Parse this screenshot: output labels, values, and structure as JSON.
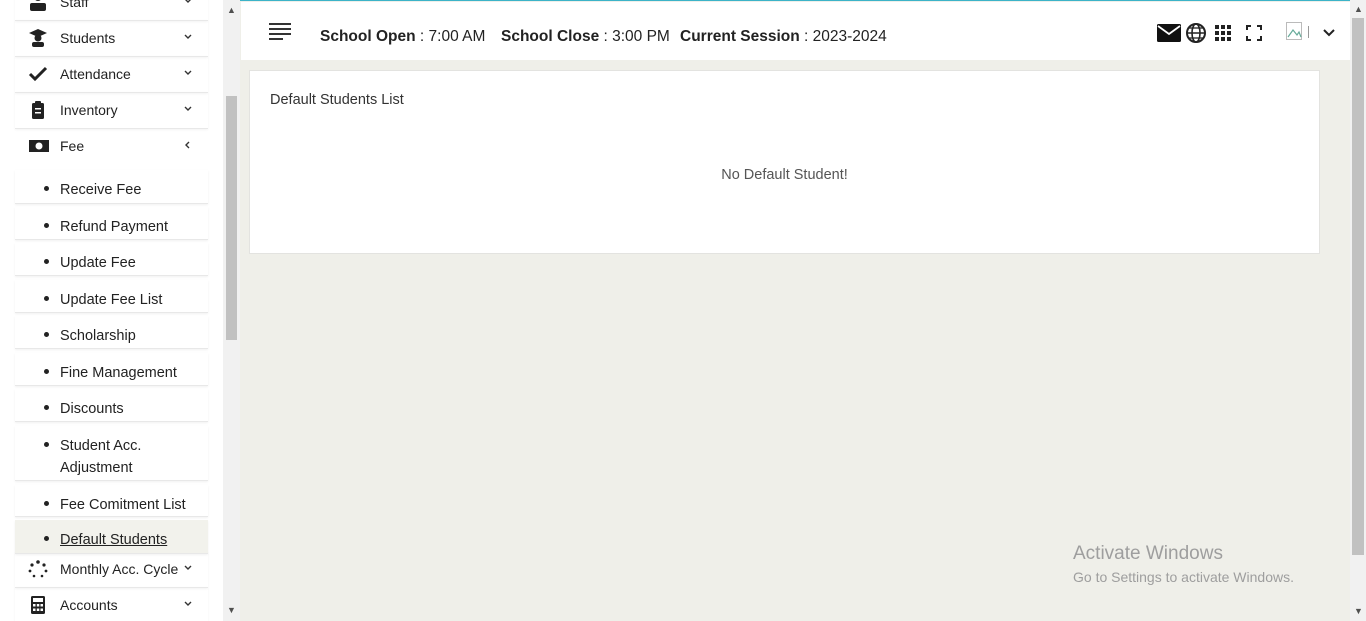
{
  "header": {
    "school_open_label": "School Open",
    "school_open_value": ": 7:00 AM",
    "school_close_label": "School Close",
    "school_close_value": ": 3:00 PM",
    "session_label": "Current Session",
    "session_value": ": 2023-2024"
  },
  "sidebar": {
    "items": [
      {
        "label": "Staff",
        "icon": "staff-icon"
      },
      {
        "label": "Students",
        "icon": "student-icon"
      },
      {
        "label": "Attendance",
        "icon": "check-icon"
      },
      {
        "label": "Inventory",
        "icon": "clipboard-icon"
      },
      {
        "label": "Fee",
        "icon": "money-icon"
      }
    ],
    "fee_submenu": [
      {
        "label": "Receive Fee"
      },
      {
        "label": "Refund Payment"
      },
      {
        "label": "Update Fee"
      },
      {
        "label": "Update Fee List"
      },
      {
        "label": "Scholarship"
      },
      {
        "label": "Fine Management"
      },
      {
        "label": "Discounts"
      },
      {
        "label": "Student Acc. Adjustment"
      },
      {
        "label": "Fee Comitment List"
      },
      {
        "label": "Default Students",
        "active": true
      }
    ],
    "items_after": [
      {
        "label": "Monthly Acc. Cycle",
        "icon": "spinner-icon"
      },
      {
        "label": "Accounts",
        "icon": "calculator-icon"
      }
    ]
  },
  "main": {
    "card_title": "Default Students List",
    "empty_message": "No Default Student!"
  },
  "watermark": {
    "line1": "Activate Windows",
    "line2": "Go to Settings to activate Windows."
  }
}
